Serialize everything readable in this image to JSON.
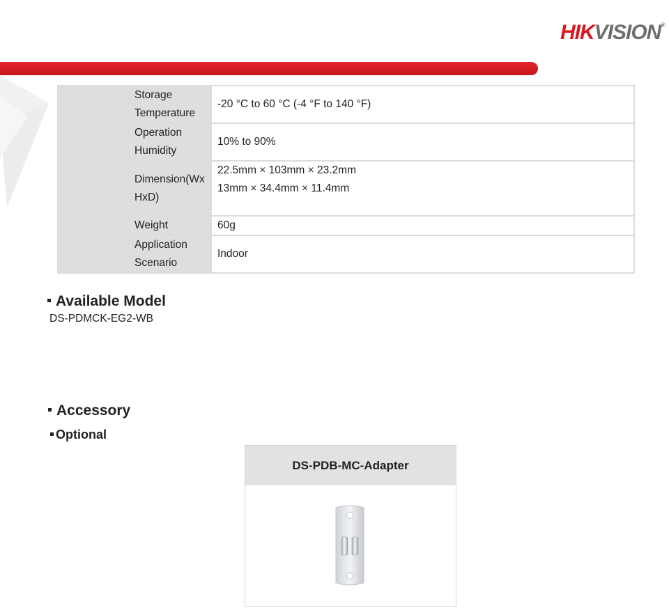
{
  "brand": {
    "hik": "HIK",
    "vision": "VISION",
    "mark": "®"
  },
  "spec_rows": [
    {
      "label": "Storage Temperature",
      "value": "-20 °C to 60 °C (-4 °F to 140 °F)"
    },
    {
      "label": "Operation Humidity",
      "value": "10% to 90%"
    },
    {
      "label": "Dimension(WxHxD)",
      "value_lines": [
        "22.5mm × 103mm × 23.2mm",
        "13mm × 34.4mm × 11.4mm"
      ]
    },
    {
      "label": "Weight",
      "value": "60g"
    },
    {
      "label": "Application Scenario",
      "value": "Indoor"
    }
  ],
  "available_model": {
    "heading": "Available Model",
    "model": "DS-PDMCK-EG2-WB"
  },
  "accessory": {
    "heading": "Accessory",
    "subheading": "Optional",
    "card_title": "DS-PDB-MC-Adapter"
  },
  "colors": {
    "brand_red": "#d7191f",
    "brand_gray": "#6d6e71",
    "cell_gray": "#dedede"
  }
}
